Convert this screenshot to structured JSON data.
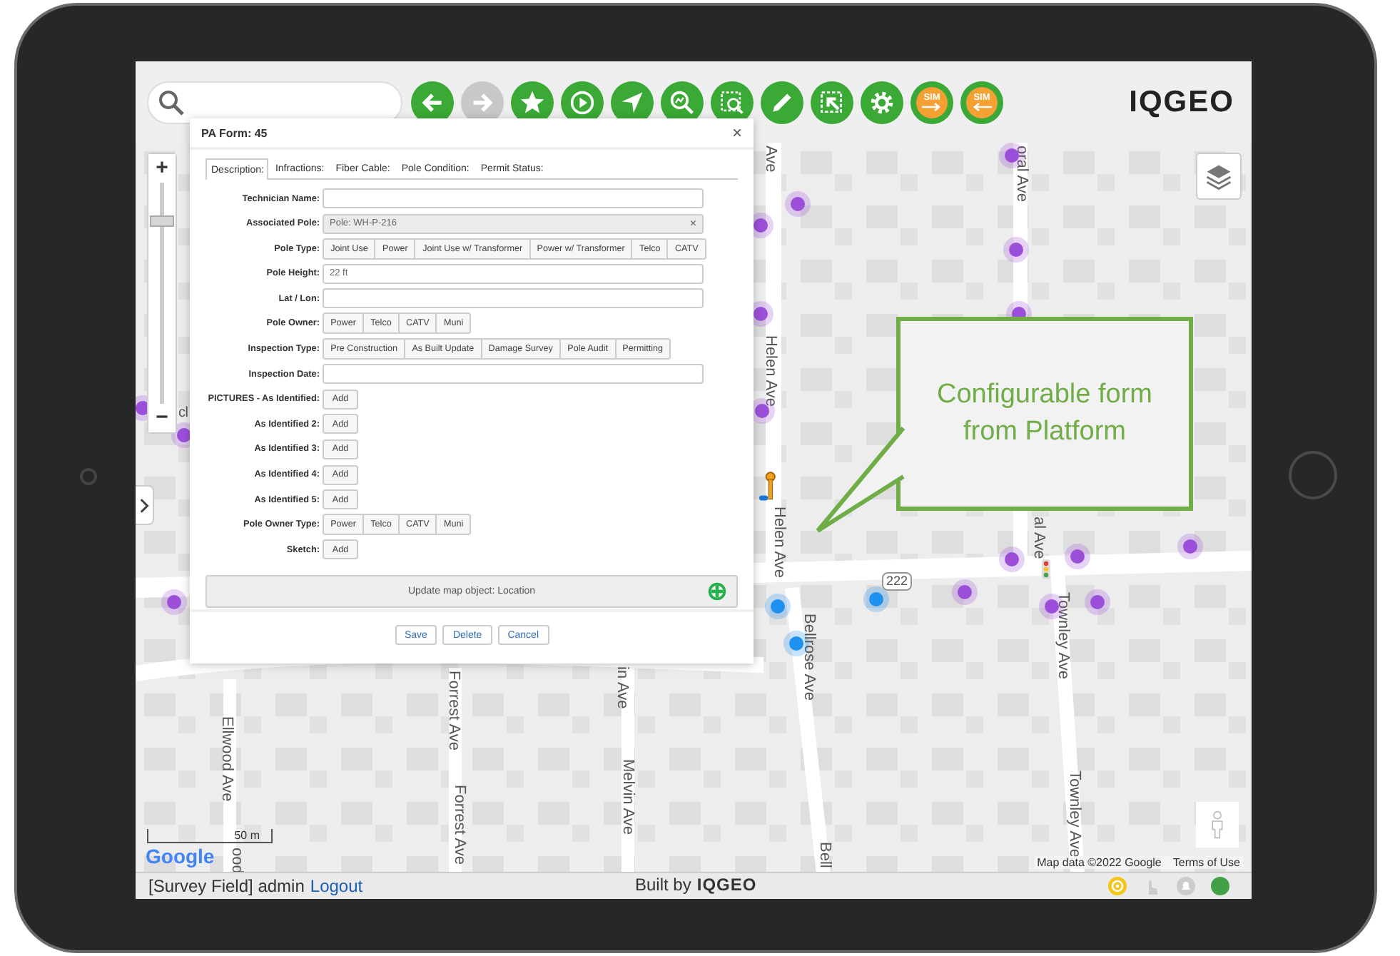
{
  "toolbar": {
    "buttons": [
      {
        "kind": "back",
        "disabled": false
      },
      {
        "kind": "forward",
        "disabled": true
      },
      {
        "kind": "favorite",
        "disabled": false
      },
      {
        "kind": "play",
        "disabled": false
      },
      {
        "kind": "locate",
        "disabled": false
      },
      {
        "kind": "zoom_chart",
        "disabled": false
      },
      {
        "kind": "zoom_select",
        "disabled": false
      },
      {
        "kind": "edit",
        "disabled": false
      },
      {
        "kind": "select",
        "disabled": false
      },
      {
        "kind": "settings",
        "disabled": false
      },
      {
        "kind": "sim_out",
        "disabled": false,
        "label": "SIM"
      },
      {
        "kind": "sim_in",
        "disabled": false,
        "label": "SIM"
      }
    ],
    "logo": "IQGEO"
  },
  "map": {
    "zoom": {
      "plus": "+",
      "minus": "−",
      "level": 0.84
    },
    "street_labels": [
      "Ave",
      "oral Ave",
      "Helen Ave",
      "Helen Ave",
      "al Ave",
      "Bellrose Ave",
      "Townley Ave",
      "Townley Ave",
      "Forrest Ave",
      "Forrest Ave",
      "in Ave",
      "Melvin Ave",
      "Ellwood Ave",
      "Bell",
      "cl",
      "ood"
    ],
    "route_shield": "222",
    "scale": "50 m",
    "google": "Google",
    "attribution": "Map data ©2022 Google",
    "terms": "Terms of Use"
  },
  "form": {
    "title": "PA Form: 45",
    "close": "×",
    "tabs": [
      {
        "label": "Description:",
        "selected": true
      },
      {
        "label": "Infractions:",
        "selected": false
      },
      {
        "label": "Fiber Cable:",
        "selected": false
      },
      {
        "label": "Pole Condition:",
        "selected": false
      },
      {
        "label": "Permit Status:",
        "selected": false
      }
    ],
    "fields": [
      {
        "kind": "text",
        "label": "Technician Name:"
      },
      {
        "kind": "reference",
        "label": "Associated Pole:",
        "value": "Pole: WH-P-216",
        "clear": "×"
      },
      {
        "kind": "choice",
        "label": "Pole Type:",
        "options": [
          {
            "label": "Joint Use",
            "selected": false
          },
          {
            "label": "Power",
            "selected": false
          },
          {
            "label": "Joint Use w/ Transformer",
            "selected": false
          },
          {
            "label": "Power w/ Transformer",
            "selected": false
          },
          {
            "label": "Telco",
            "selected": false
          },
          {
            "label": "CATV",
            "selected": false
          }
        ]
      },
      {
        "kind": "text",
        "label": "Pole Height:",
        "value": "22 ft"
      },
      {
        "kind": "text",
        "label": "Lat / Lon:"
      },
      {
        "kind": "choice",
        "label": "Pole Owner:",
        "options": [
          {
            "label": "Power",
            "selected": false
          },
          {
            "label": "Telco",
            "selected": false
          },
          {
            "label": "CATV",
            "selected": false
          },
          {
            "label": "Muni",
            "selected": false
          }
        ]
      },
      {
        "kind": "choice",
        "label": "Inspection Type:",
        "options": [
          {
            "label": "Pre Construction",
            "selected": false
          },
          {
            "label": "As Built Update",
            "selected": false
          },
          {
            "label": "Damage Survey",
            "selected": false
          },
          {
            "label": "Pole Audit",
            "selected": false
          },
          {
            "label": "Permitting",
            "selected": false
          }
        ]
      },
      {
        "kind": "text",
        "label": "Inspection Date:"
      },
      {
        "kind": "add",
        "label": "PICTURES - As Identified:",
        "button": "Add"
      },
      {
        "kind": "add",
        "label": "As Identified 2:",
        "button": "Add"
      },
      {
        "kind": "add",
        "label": "As Identified 3:",
        "button": "Add"
      },
      {
        "kind": "add",
        "label": "As Identified 4:",
        "button": "Add"
      },
      {
        "kind": "add",
        "label": "As Identified 5:",
        "button": "Add"
      },
      {
        "kind": "choice",
        "label": "Pole Owner Type:",
        "options": [
          {
            "label": "Power",
            "selected": false
          },
          {
            "label": "Telco",
            "selected": false
          },
          {
            "label": "CATV",
            "selected": false
          },
          {
            "label": "Muni",
            "selected": false
          }
        ]
      },
      {
        "kind": "add",
        "label": "Sketch:",
        "button": "Add"
      }
    ],
    "location_bar": "Update map object: Location",
    "actions": [
      "Save",
      "Delete",
      "Cancel"
    ]
  },
  "callout": {
    "text": "Configurable form from Platform"
  },
  "status_bar": {
    "user": "[Survey Field] admin",
    "logout": "Logout",
    "built_by": "Built by",
    "logo": "IQGEO"
  }
}
